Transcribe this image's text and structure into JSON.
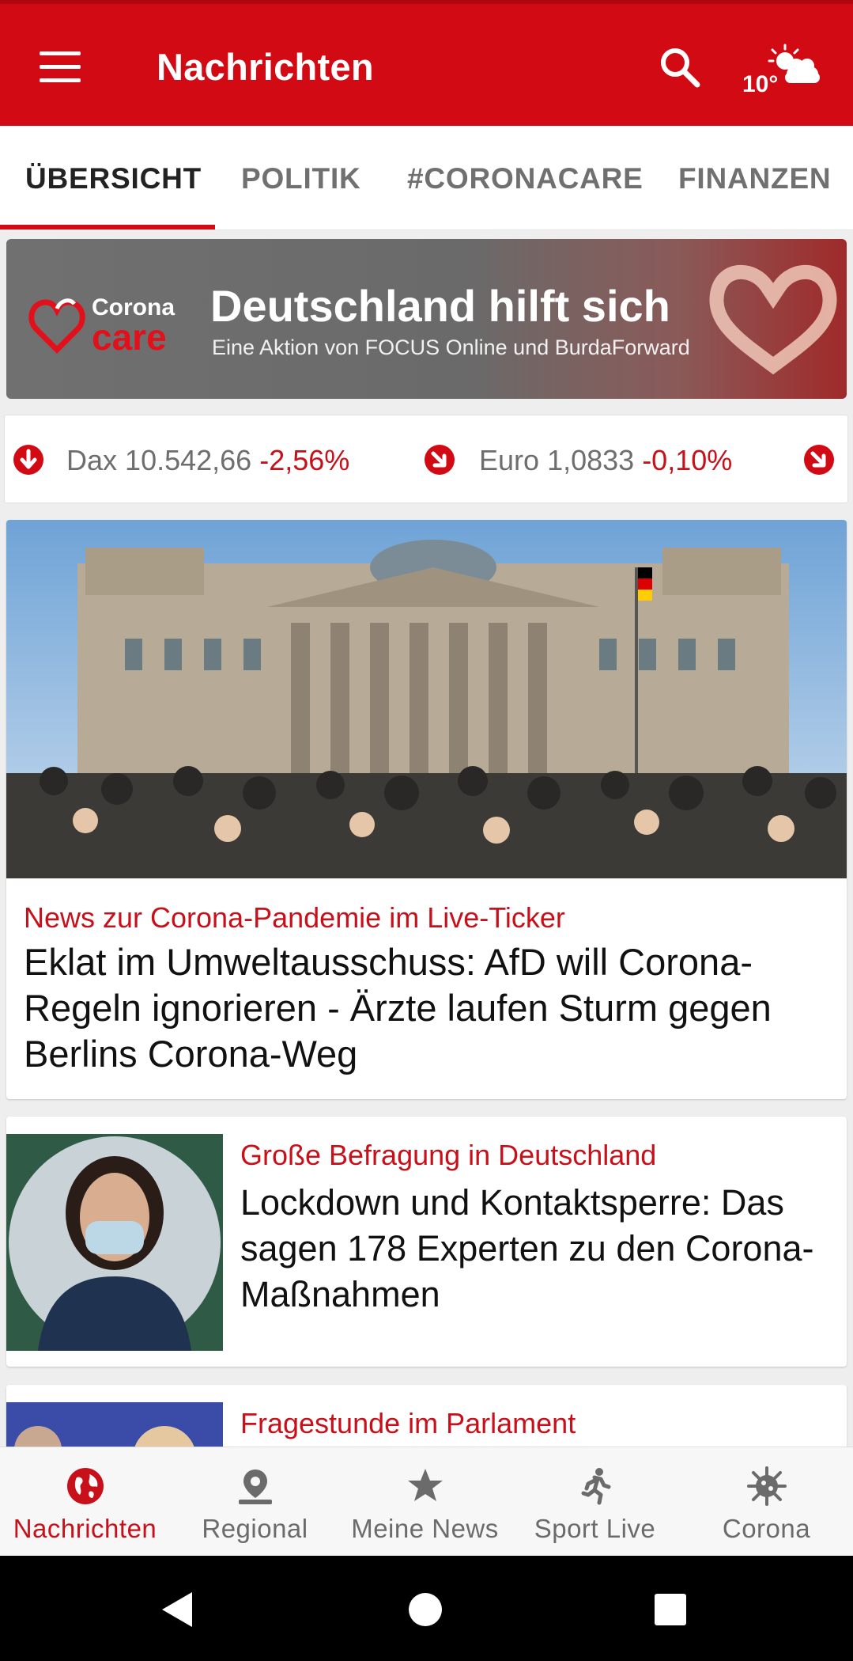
{
  "appbar": {
    "title": "Nachrichten",
    "menu_icon": "hamburger-menu-icon",
    "search_icon": "search-icon",
    "weather": {
      "temperature": "10°",
      "icon": "partly-cloudy-icon"
    },
    "colors": {
      "brand": "#d20a14"
    }
  },
  "tabs": [
    {
      "label": "ÜBERSICHT",
      "active": true
    },
    {
      "label": "POLITIK",
      "active": false
    },
    {
      "label": "#CORONACARE",
      "active": false
    },
    {
      "label": "FINANZEN",
      "active": false
    }
  ],
  "banner": {
    "logo_word1": "Corona",
    "logo_word2": "care",
    "title": "Deutschland hilft sich",
    "subtitle": "Eine Aktion von FOCUS Online und BurdaForward"
  },
  "ticker": [
    {
      "name": "Dax",
      "value": "10.542,66",
      "change": "-2,56%",
      "icon": "arrow-down-icon"
    },
    {
      "name": "Euro",
      "value": "1,0833",
      "change": "-0,10%",
      "icon": "arrow-down-right-icon"
    },
    {
      "icon": "arrow-down-right-icon"
    }
  ],
  "articles": [
    {
      "kicker": "News zur Corona-Pandemie im Live-Ticker",
      "headline": "Eklat im Umweltausschuss: AfD will Corona-Regeln ignorieren - Ärzte laufen Sturm gegen Berlins Corona-Weg",
      "image": "reichstag-crowd-photo"
    },
    {
      "kicker": "Große Befragung in Deutschland",
      "headline": "Lockdown und Kontaktsperre: Das sagen 178 Experten zu den Corona-Maßnahmen",
      "image": "woman-with-mask-photo"
    },
    {
      "kicker": "Fragestunde im Parlament",
      "headline": "",
      "image": "parliament-photo"
    }
  ],
  "bottom_nav": [
    {
      "label": "Nachrichten",
      "icon": "globe-icon",
      "active": true
    },
    {
      "label": "Regional",
      "icon": "location-pin-icon",
      "active": false
    },
    {
      "label": "Meine News",
      "icon": "star-icon",
      "active": false
    },
    {
      "label": "Sport Live",
      "icon": "runner-icon",
      "active": false
    },
    {
      "label": "Corona",
      "icon": "virus-icon",
      "active": false
    }
  ],
  "system_nav": [
    "back-icon",
    "home-icon",
    "recents-icon"
  ]
}
